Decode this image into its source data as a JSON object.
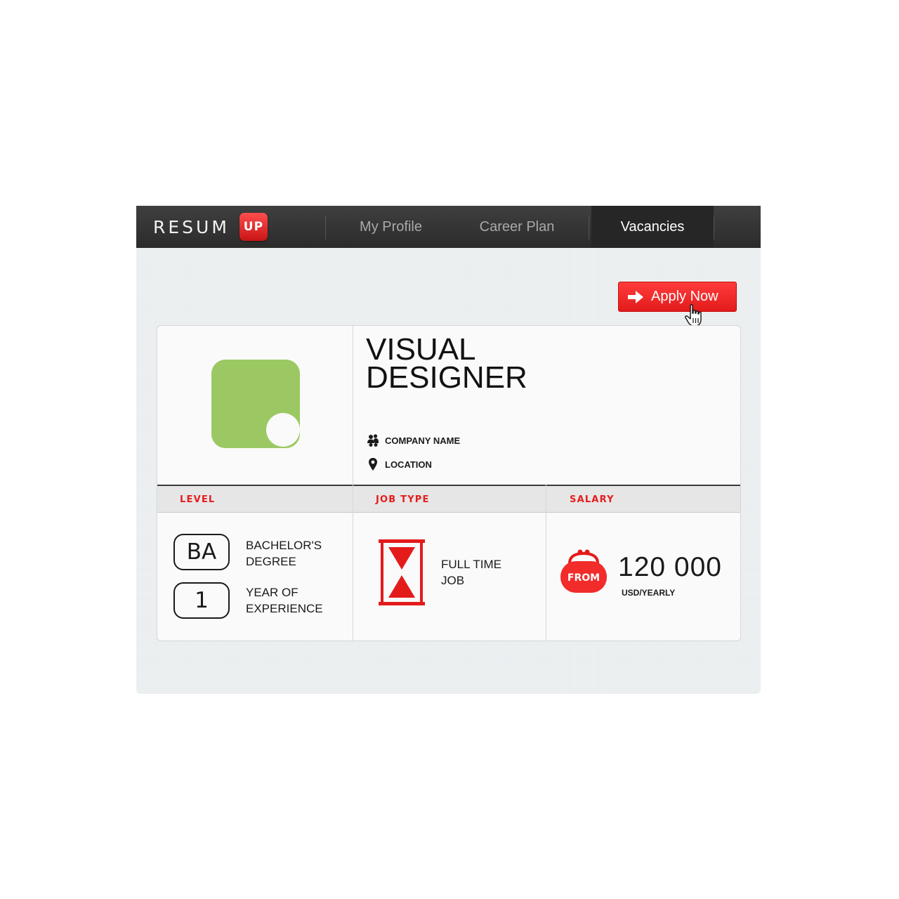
{
  "brand": {
    "name": "RESUM",
    "badge": "UP"
  },
  "nav": {
    "items": [
      "My Profile",
      "Career Plan",
      "Vacancies"
    ],
    "active": "Vacancies"
  },
  "actions": {
    "apply_label": "Apply Now"
  },
  "job": {
    "title_line1": "VISUAL",
    "title_line2": "DESIGNER",
    "company": "COMPANY NAME",
    "location": "LOCATION"
  },
  "stats": {
    "level": {
      "label": "LEVEL",
      "degree_badge": "BA",
      "degree_line1": "BACHELOR'S",
      "degree_line2": "DEGREE",
      "experience_badge": "1",
      "experience_line1": "YEAR OF",
      "experience_line2": "EXPERIENCE"
    },
    "job_type": {
      "label": "JOB TYPE",
      "line1": "FULL TIME",
      "line2": "JOB"
    },
    "salary": {
      "label": "SALARY",
      "prefix": "FROM",
      "amount": "120 000",
      "unit": "USD/YEARLY"
    }
  },
  "colors": {
    "accent": "#e31b1b",
    "logo_green": "#9bc862",
    "navbar": "#333333"
  }
}
